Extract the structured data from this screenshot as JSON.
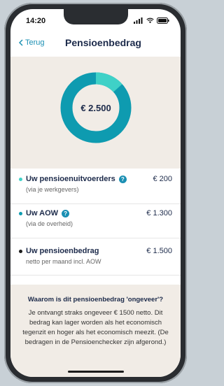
{
  "status_bar": {
    "time": "14:20",
    "icons": [
      "signal-icon",
      "wifi-icon",
      "battery-icon"
    ]
  },
  "nav": {
    "back_label": "Terug",
    "title": "Pensioenbedrag"
  },
  "chart_data": {
    "type": "pie",
    "center_label": "€ 2.500",
    "series": [
      {
        "name": "Uw pensioenuitvoerders",
        "value": 200,
        "color": "#3fd1c7"
      },
      {
        "name": "Uw AOW",
        "value": 1300,
        "color": "#0e9bb0"
      }
    ],
    "total": 2500
  },
  "rows": [
    {
      "title": "Uw pensioenuitvoerders",
      "subtitle": "(via je werkgevers)",
      "amount": "€ 200",
      "dot_color": "#3fd1c7",
      "has_help": true
    },
    {
      "title": "Uw AOW",
      "subtitle": "(via de overheid)",
      "amount": "€ 1.300",
      "dot_color": "#0e9bb0",
      "has_help": true
    },
    {
      "title": "Uw pensioenbedrag",
      "subtitle": "netto per maand incl. AOW",
      "amount": "€ 1.500",
      "dot_color": "#1c1c1c",
      "has_help": false
    }
  ],
  "info": {
    "title": "Waarom is dit pensioenbedrag 'ongeveer'?",
    "body": "Je ontvangt straks ongeveer € 1500 netto. Dit bedrag kan lager worden als het economisch tegenzit en hoger als het economisch meezit. (De bedragen in de Pensioenchecker zijn afgerond.)"
  },
  "colors": {
    "accent": "#1a8fb3",
    "title": "#1c2a4a",
    "panel_bg": "#f1ece6"
  }
}
